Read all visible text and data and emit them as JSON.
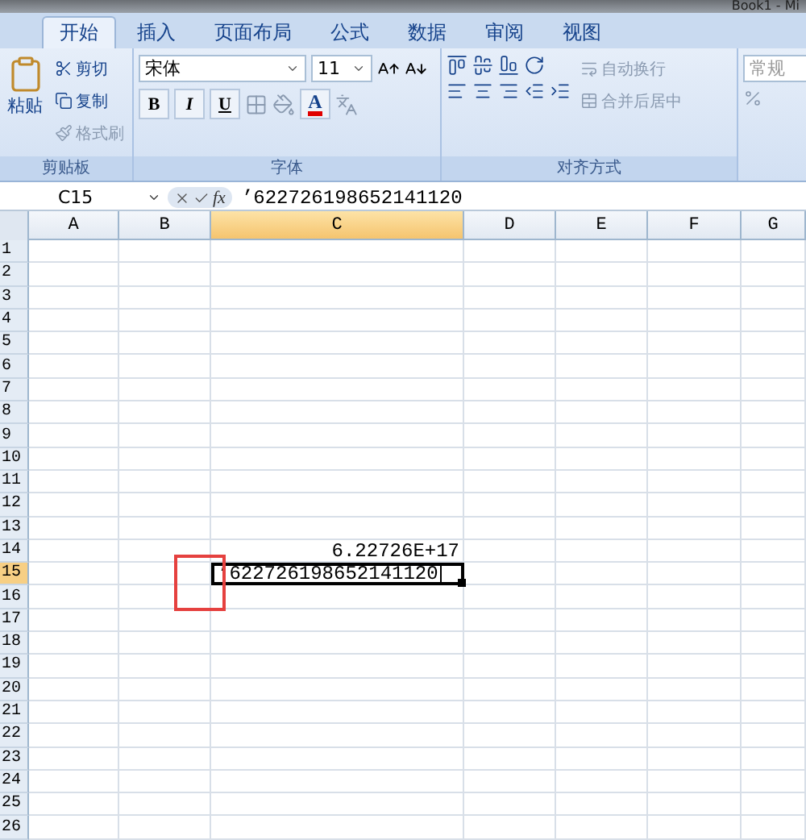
{
  "window": {
    "title": "Book1 - Mi"
  },
  "tabs": [
    {
      "label": "开始",
      "selected": true
    },
    {
      "label": "插入",
      "selected": false
    },
    {
      "label": "页面布局",
      "selected": false
    },
    {
      "label": "公式",
      "selected": false
    },
    {
      "label": "数据",
      "selected": false
    },
    {
      "label": "审阅",
      "selected": false
    },
    {
      "label": "视图",
      "selected": false
    }
  ],
  "ribbon": {
    "clipboard": {
      "paste": "粘贴",
      "cut": "剪切",
      "copy": "复制",
      "format_painter": "格式刷",
      "label": "剪贴板"
    },
    "font": {
      "name": "宋体",
      "size": "11",
      "bold": "B",
      "italic": "I",
      "underline": "U",
      "font_color": "A",
      "label": "字体"
    },
    "alignment": {
      "wrap": "自动换行",
      "merge": "合并后居中",
      "label": "对齐方式"
    },
    "number": {
      "format": "常规"
    }
  },
  "formula_bar": {
    "name_box": "C15",
    "fx": "fx",
    "content": "’622726198652141120"
  },
  "sheet": {
    "columns": [
      {
        "label": "A",
        "selected": false
      },
      {
        "label": "B",
        "selected": false
      },
      {
        "label": "C",
        "selected": true
      },
      {
        "label": "D",
        "selected": false
      },
      {
        "label": "E",
        "selected": false
      },
      {
        "label": "F",
        "selected": false
      },
      {
        "label": "G",
        "selected": false
      }
    ],
    "rows": [
      {
        "label": "1",
        "selected": false
      },
      {
        "label": "2",
        "selected": false
      },
      {
        "label": "3",
        "selected": false
      },
      {
        "label": "4",
        "selected": false
      },
      {
        "label": "5",
        "selected": false
      },
      {
        "label": "6",
        "selected": false
      },
      {
        "label": "7",
        "selected": false
      },
      {
        "label": "8",
        "selected": false
      },
      {
        "label": "9",
        "selected": false
      },
      {
        "label": "10",
        "selected": false
      },
      {
        "label": "11",
        "selected": false
      },
      {
        "label": "12",
        "selected": false
      },
      {
        "label": "13",
        "selected": false
      },
      {
        "label": "14",
        "selected": false,
        "column_c": {
          "kind": "value",
          "text": "6.22726E+17"
        }
      },
      {
        "label": "15",
        "selected": true,
        "column_c": {
          "kind": "editing",
          "text": "’622726198652141120"
        }
      },
      {
        "label": "16",
        "selected": false
      },
      {
        "label": "17",
        "selected": false
      },
      {
        "label": "18",
        "selected": false
      },
      {
        "label": "19",
        "selected": false
      },
      {
        "label": "20",
        "selected": false
      },
      {
        "label": "21",
        "selected": false
      },
      {
        "label": "22",
        "selected": false
      },
      {
        "label": "23",
        "selected": false
      },
      {
        "label": "24",
        "selected": false
      },
      {
        "label": "25",
        "selected": false
      },
      {
        "label": "26",
        "selected": false
      }
    ]
  }
}
